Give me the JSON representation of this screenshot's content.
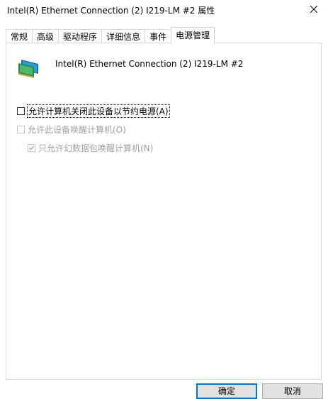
{
  "window": {
    "title": "Intel(R) Ethernet Connection (2) I219-LM #2 属性"
  },
  "tabs": [
    {
      "label": "常规",
      "active": false
    },
    {
      "label": "高级",
      "active": false
    },
    {
      "label": "驱动程序",
      "active": false
    },
    {
      "label": "详细信息",
      "active": false
    },
    {
      "label": "事件",
      "active": false
    },
    {
      "label": "电源管理",
      "active": true
    }
  ],
  "device": {
    "name": "Intel(R) Ethernet Connection (2) I219-LM #2",
    "icon": "network-adapter-icon"
  },
  "power_options": [
    {
      "label": "允许计算机关闭此设备以节约电源(A)",
      "checked": false,
      "enabled": true
    },
    {
      "label": "允许此设备唤醒计算机(O)",
      "checked": false,
      "enabled": false
    },
    {
      "label": "只允许幻数据包唤醒计算机(N)",
      "checked": true,
      "enabled": false
    }
  ],
  "buttons": {
    "ok_label": "确定",
    "cancel_label": "取消"
  },
  "colors": {
    "accent": "#0078d7",
    "disabled_text": "#a0a0a0"
  }
}
